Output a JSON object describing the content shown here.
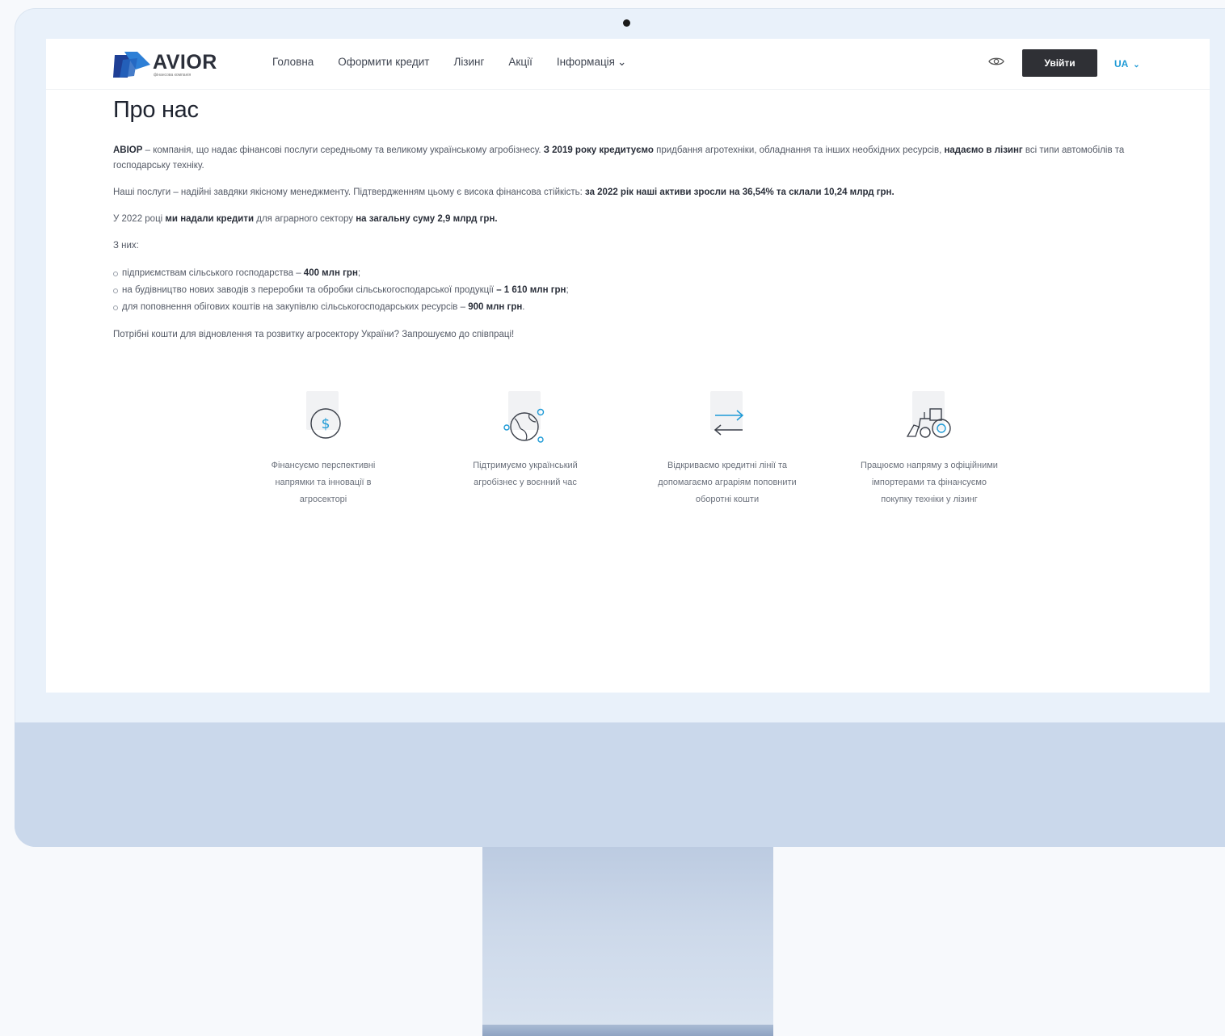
{
  "nav": {
    "logo_text": "AVIOR",
    "logo_subtext": "фінансова компанія",
    "menu": [
      "Головна",
      "Оформити кредит",
      "Лізинг",
      "Акції",
      "Інформація"
    ],
    "login_label": "Увійти",
    "lang_label": "UA"
  },
  "page": {
    "title": "Про нас",
    "p1": {
      "a": "АВІОР",
      "b": " – компанія, що надає фінансові послуги середньому та великому українському агробізнесу. ",
      "c": "З 2019 року кредитуємо",
      "d": " придбання агротехніки, обладнання та інших необхідних ресурсів, ",
      "e": "надаємо в лізинг",
      "f": " всі типи автомобілів та господарську техніку."
    },
    "p2": {
      "a": "Наші послуги – надійні завдяки якісному менеджменту. Підтвердженням цьому є висока фінансова стійкість: ",
      "b": "за 2022 рік наші активи зросли на 36,54% та склали 10,24 млрд грн."
    },
    "p3": {
      "a": "У 2022 році ",
      "b": "ми надали кредити",
      "c": " для аграрного сектору ",
      "d": "на загальну суму 2,9 млрд грн."
    },
    "p4": "З них:",
    "items": [
      {
        "text": "підприємствам сільського господарства – ",
        "bold": "400 млн грн",
        "end": ";"
      },
      {
        "text": "на будівництво нових заводів з переробки та обробки сільськогосподарської продукції ",
        "bold": "– 1 610 млн грн",
        "end": ";"
      },
      {
        "text": "для поповнення обігових коштів на закупівлю сільськогосподарських ресурсів – ",
        "bold": "900 млн грн",
        "end": "."
      }
    ],
    "p5": "Потрібні кошти для відновлення та розвитку агросектору України? Запрошуємо до співпраці!"
  },
  "features": [
    {
      "icon": "dollar-coin-icon",
      "caption": "Фінансуємо перспективні напрямки та інновації в агросекторі"
    },
    {
      "icon": "globe-gears-icon",
      "caption": "Підтримуємо український агробізнес у воєнний час"
    },
    {
      "icon": "transfer-arrows-icon",
      "caption": "Відкриваємо кредитні лінії та допомагаємо аграріям поповнити оборотні кошти"
    },
    {
      "icon": "tractor-icon",
      "caption": "Працюємо напряму з офіційними імпортерами та фінансуємо покупку техніки у лізинг"
    }
  ],
  "colors": {
    "accent": "#1e9ad6",
    "logo_dark_blue": "#1f3f95",
    "logo_light_blue": "#2d7fd6",
    "login_bg": "#2f3035"
  }
}
